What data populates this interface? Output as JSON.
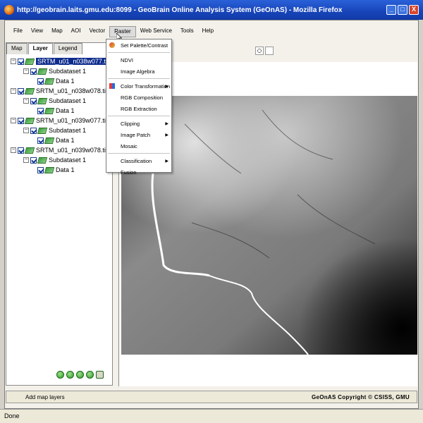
{
  "window": {
    "title": "http://geobrain.laits.gmu.edu:8099 - GeoBrain Online Analysis System (GeOnAS) - Mozilla Firefox",
    "controls": [
      "_",
      "□",
      "X"
    ]
  },
  "menubar": {
    "items": [
      "File",
      "View",
      "Map",
      "AOI",
      "Vector",
      "Raster",
      "Web Service",
      "Tools",
      "Help"
    ],
    "active": "Raster"
  },
  "left_panel": {
    "tabs": [
      "Map",
      "Layer",
      "Legend"
    ],
    "active_tab": "Layer",
    "layers": [
      {
        "name": "SRTM_u01_n038w077.tif",
        "subdataset": "Subdataset 1",
        "data": "Data 1",
        "selected": true
      },
      {
        "name": "SRTM_u01_n038w078.tif",
        "subdataset": "Subdataset 1",
        "data": "Data 1",
        "selected": false
      },
      {
        "name": "SRTM_u01_n039w077.tif",
        "subdataset": "Subdataset 1",
        "data": "Data 1",
        "selected": false
      },
      {
        "name": "SRTM_u01_n039w078.tif",
        "subdataset": "Subdataset 1",
        "data": "Data 1",
        "selected": false
      }
    ]
  },
  "raster_menu": {
    "items": [
      {
        "label": "Set Palette/Contrast",
        "submenu": false
      },
      {
        "label": "NDVI",
        "submenu": false
      },
      {
        "label": "Image Algebra",
        "submenu": false
      },
      {
        "label": "Color Transformation",
        "submenu": true
      },
      {
        "label": "RGB Composition",
        "submenu": false
      },
      {
        "label": "RGB Extraction",
        "submenu": false
      },
      {
        "label": "Clipping",
        "submenu": true
      },
      {
        "label": "Image Patch",
        "submenu": true
      },
      {
        "label": "Mosaic",
        "submenu": false
      },
      {
        "label": "Classification",
        "submenu": true
      },
      {
        "label": "Fusion",
        "submenu": false
      }
    ]
  },
  "statusbar": {
    "left": "Add map layers",
    "right": "GeOnAS Copyright © CSISS, GMU"
  },
  "browser_status": "Done",
  "colors": {
    "titlebar": "#1744b8",
    "selection": "#0c2b8c",
    "layer_icon": "#3a9e3a"
  }
}
